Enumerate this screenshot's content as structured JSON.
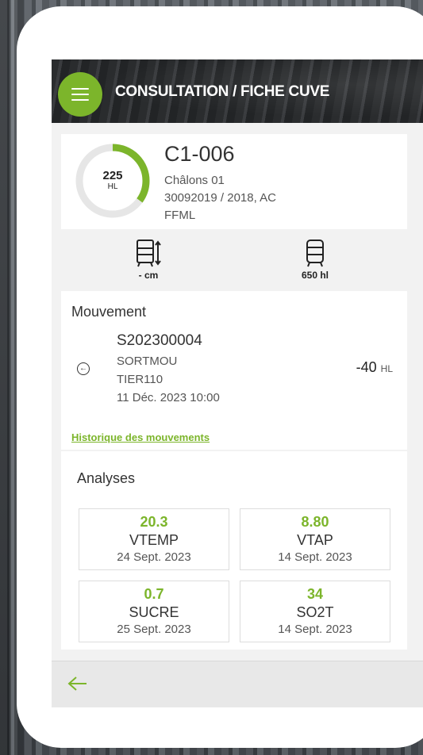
{
  "header": {
    "title": "CONSULTATION / FICHE CUVE",
    "menu_icon": "hamburger-icon"
  },
  "tank": {
    "code": "C1-006",
    "location": "Châlons 01",
    "lot": "30092019 / 2018, AC",
    "product": "FFML",
    "volume": "225",
    "volume_unit": "HL",
    "fill_fraction": 0.35,
    "accent": "#7cb52b"
  },
  "capacity": {
    "level_label": "- cm",
    "capacity_label": "650 hl"
  },
  "movement": {
    "section_title": "Mouvement",
    "number": "S202300004",
    "type": "SORTMOU",
    "tier": "TIER110",
    "date": "11 Déc. 2023 10:00",
    "quantity": "-40",
    "quantity_unit": "HL",
    "history_link": "Historique des mouvements"
  },
  "analyses": {
    "section_title": "Analyses",
    "tiles": [
      {
        "value": "20.3",
        "name": "VTEMP",
        "date": "24 Sept. 2023"
      },
      {
        "value": "8.80",
        "name": "VTAP",
        "date": "14 Sept. 2023"
      },
      {
        "value": "0.7",
        "name": "SUCRE",
        "date": "25 Sept. 2023"
      },
      {
        "value": "34",
        "name": "SO2T",
        "date": "14 Sept. 2023"
      }
    ]
  }
}
